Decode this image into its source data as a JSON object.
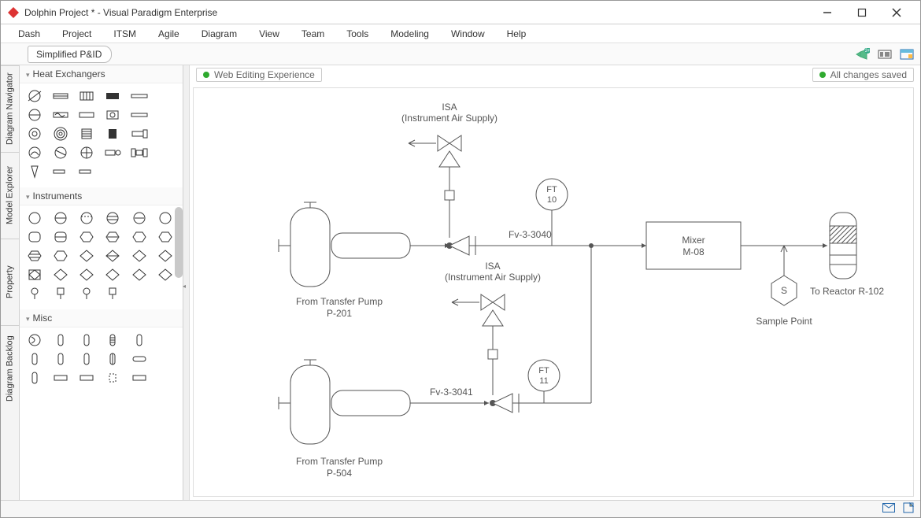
{
  "window_title": "Dolphin Project * - Visual Paradigm Enterprise",
  "menu": [
    "Dash",
    "Project",
    "ITSM",
    "Agile",
    "Diagram",
    "View",
    "Team",
    "Tools",
    "Modeling",
    "Window",
    "Help"
  ],
  "tab": "Simplified P&ID",
  "vertical_tabs": [
    "Diagram Navigator",
    "Model Explorer",
    "Property",
    "Diagram Backlog"
  ],
  "palette_categories": [
    "Heat Exchangers",
    "Instruments",
    "Misc"
  ],
  "status_left": "Web Editing Experience",
  "status_right": "All changes saved",
  "diagram": {
    "isa1_title": "ISA",
    "isa1_sub": "(Instrument Air Supply)",
    "isa2_title": "ISA",
    "isa2_sub": "(Instrument Air Supply)",
    "pump1_l1": "From Transfer Pump",
    "pump1_l2": "P-201",
    "pump2_l1": "From Transfer Pump",
    "pump2_l2": "P-504",
    "valve1_label": "Fv-3-3040",
    "valve2_label": "Fv-3-3041",
    "ft1_a": "FT",
    "ft1_b": "10",
    "ft2_a": "FT",
    "ft2_b": "11",
    "mixer_a": "Mixer",
    "mixer_b": "M-08",
    "sample_letter": "S",
    "sample_label": "Sample Point",
    "reactor_label": "To Reactor R-102"
  }
}
